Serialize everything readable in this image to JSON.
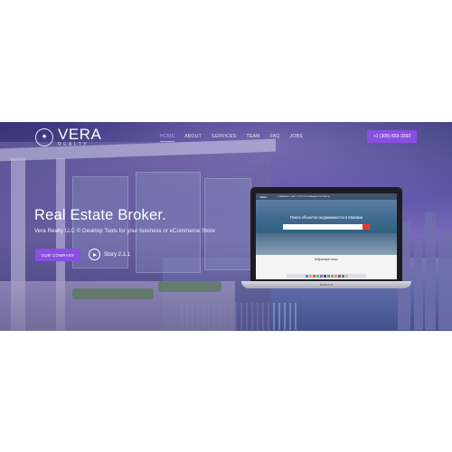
{
  "brand": {
    "name": "VERA",
    "sub": "REALTY",
    "mark": "✦"
  },
  "nav": {
    "items": [
      "HOME",
      "ABOUT",
      "SERVICES",
      "TEAM",
      "FAQ",
      "JOBS"
    ],
    "active": "HOME",
    "phone": "+1 (305) 833-3393"
  },
  "hero": {
    "headline": "Real Estate Broker.",
    "subline": "Vera Realty LLC © Desktop Tools for your business or eCommerce Store",
    "cta_label": "OUR COMPANY",
    "play_label": "Story 2.1.1"
  },
  "laptop": {
    "screen_logo": "VERA",
    "screen_nav": "ГЛАВНАЯ   О НАС   УСЛУГИ   КОМАНДА   КОНТАКТЫ",
    "screen_title": "Поиск объектов недвижимости в Майами",
    "screen_section": "Избранные спосо",
    "base_label": "MacBook Air"
  },
  "colors": {
    "accent": "#8a4fe0",
    "active_nav": "#b9a9ff",
    "page_bg": "#ffffff"
  }
}
